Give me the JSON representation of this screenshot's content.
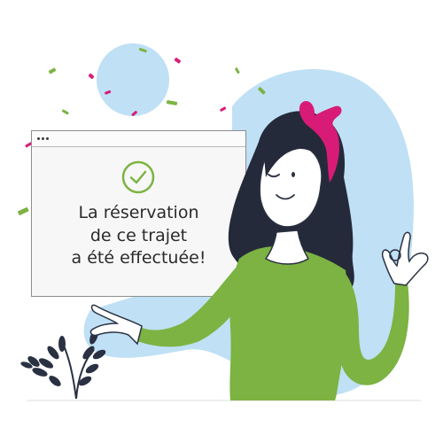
{
  "confirmation_card": {
    "icon": "check-circle-icon",
    "message_lines": [
      "La réservation",
      "de ce trajet",
      "a été effectuée!"
    ]
  },
  "colors": {
    "accent_green": "#7cb342",
    "sky_blue": "#bfe0f5",
    "ribbon_pink": "#d81b76",
    "hair": "#252a3a",
    "card_bg": "#f7f7f7"
  }
}
